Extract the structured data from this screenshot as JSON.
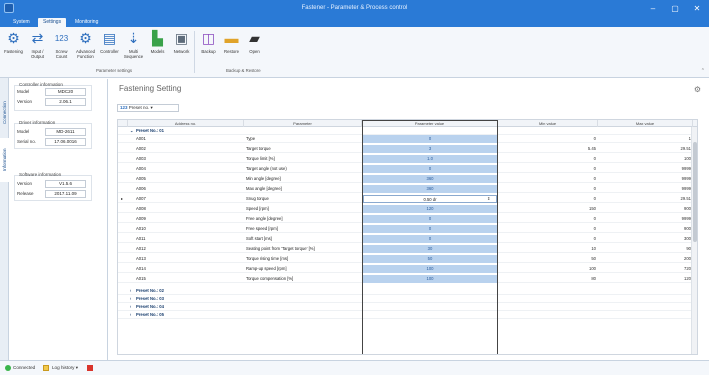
{
  "window": {
    "title": "Fastener - Parameter & Process control",
    "minimize": "–",
    "maximize": "▢",
    "close": "✕"
  },
  "tabs": [
    "System",
    "Settings",
    "Monitoring"
  ],
  "ribbon": {
    "buttons": [
      {
        "label": "Fastening",
        "icon": "gear-icon",
        "glyph": "⚙"
      },
      {
        "label": "Input / Output",
        "icon": "io-icon",
        "glyph": "⇄"
      },
      {
        "label": "Screw Count",
        "icon": "counter-icon",
        "glyph": "123"
      },
      {
        "label": "Advanced Function",
        "icon": "advanced-gears-icon",
        "glyph": "⚙"
      },
      {
        "label": "Controller",
        "icon": "controller-icon",
        "glyph": "▤"
      },
      {
        "label": "Multi Sequence",
        "icon": "multi-sequence-icon",
        "glyph": "⇣"
      },
      {
        "label": "Models",
        "icon": "models-icon",
        "glyph": "▙"
      },
      {
        "label": "Network",
        "icon": "network-icon",
        "glyph": "▣"
      },
      {
        "label": "Backup",
        "icon": "backup-icon",
        "glyph": "◫"
      },
      {
        "label": "Restore",
        "icon": "restore-icon",
        "glyph": "▬"
      },
      {
        "label": "Open",
        "icon": "open-folder-icon",
        "glyph": "▰"
      }
    ],
    "group_parameter": "Parameter settings",
    "group_backup": "Backup & Restore"
  },
  "sidetabs": [
    "Connection",
    "Information"
  ],
  "left_panel": {
    "controller": {
      "title": "Controller information",
      "model_label": "Model",
      "model": "MDC20",
      "version_label": "Version",
      "version": "2.06.1"
    },
    "driver": {
      "title": "Driver information",
      "model_label": "Model",
      "model": "MD-2611",
      "serial_label": "Serial no.",
      "serial": "17.06.0016"
    },
    "software": {
      "title": "Software information",
      "version_label": "Version",
      "version": "V1.5.6",
      "release_label": "Release",
      "release": "2017.11.09"
    }
  },
  "main": {
    "title": "Fastening Setting",
    "preset_prefix": "123",
    "preset_value": "Preset no. ▾",
    "columns": [
      "Address no.",
      "Parameter",
      "Parameter value",
      "Min value",
      "Max value"
    ],
    "preset1_label": "Preset No.: 01",
    "rows": [
      {
        "addr": "A001",
        "param": "Type",
        "value": "0",
        "min": "0",
        "max": "1"
      },
      {
        "addr": "A002",
        "param": "Target torque",
        "value": "3",
        "min": "5.45",
        "max": "29.51"
      },
      {
        "addr": "A003",
        "param": "Torque limit [%]",
        "value": "1.0",
        "min": "0",
        "max": "100"
      },
      {
        "addr": "A004",
        "param": "Target angle (not use)",
        "value": "0",
        "min": "0",
        "max": "9999"
      },
      {
        "addr": "A005",
        "param": "Min angle [degree]",
        "value": "360",
        "min": "0",
        "max": "9999"
      },
      {
        "addr": "A006",
        "param": "Max angle [degree]",
        "value": "360",
        "min": "0",
        "max": "9999"
      },
      {
        "addr": "A007",
        "param": "Snug torque",
        "value": "0.50 dr",
        "min": "0",
        "max": "29.51",
        "selected": true
      },
      {
        "addr": "A008",
        "param": "Speed [rpm]",
        "value": "120",
        "min": "150",
        "max": "900"
      },
      {
        "addr": "A009",
        "param": "Free angle [degree]",
        "value": "0",
        "min": "0",
        "max": "9999"
      },
      {
        "addr": "A010",
        "param": "Free speed [rpm]",
        "value": "0",
        "min": "0",
        "max": "900"
      },
      {
        "addr": "A011",
        "param": "Soft start [ms]",
        "value": "0",
        "min": "0",
        "max": "300"
      },
      {
        "addr": "A012",
        "param": "Seating point from 'Target torque' [%]",
        "value": "30",
        "min": "10",
        "max": "90"
      },
      {
        "addr": "A013",
        "param": "Torque rising time [ms]",
        "value": "50",
        "min": "50",
        "max": "200"
      },
      {
        "addr": "A014",
        "param": "Ramp-up speed [rpm]",
        "value": "100",
        "min": "100",
        "max": "720"
      },
      {
        "addr": "A015",
        "param": "Torque compensation [%]",
        "value": "100",
        "min": "80",
        "max": "120"
      }
    ],
    "collapsed_presets": [
      "Preset No.: 02",
      "Preset No.: 03",
      "Preset No.: 04",
      "Preset No.: 05"
    ]
  },
  "status": {
    "connected": "Connected",
    "log_history": "Log history ▾"
  }
}
